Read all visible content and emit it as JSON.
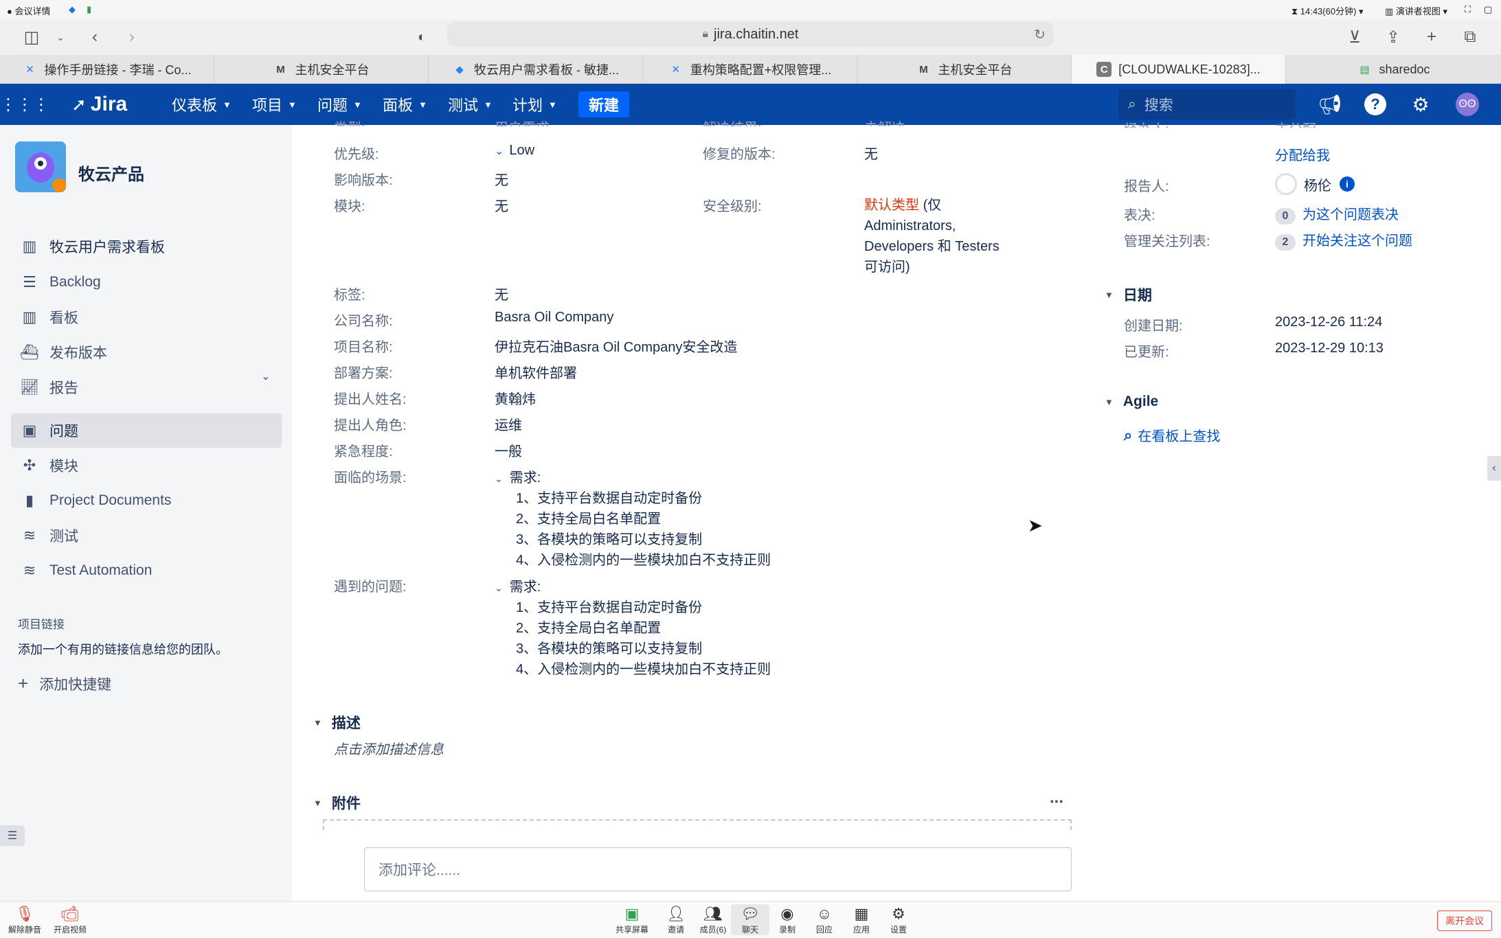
{
  "mac_bar": {
    "meeting_details": "会议详情",
    "time_remaining": "14:43(60分钟)",
    "presenter_view": "演讲者视图"
  },
  "browser": {
    "url": "jira.chaitin.net",
    "tabs": [
      {
        "label": "操作手册链接 - 李瑞 - Co...",
        "icon": "confluence-icon"
      },
      {
        "label": "主机安全平台",
        "icon": "gmail-icon"
      },
      {
        "label": "牧云用户需求看板 - 敏捷...",
        "icon": "jira-icon"
      },
      {
        "label": "重构策略配置+权限管理...",
        "icon": "confluence-icon"
      },
      {
        "label": "主机安全平台",
        "icon": "gmail-icon"
      },
      {
        "label": "[CLOUDWALKE-10283]...",
        "icon": "c-icon"
      },
      {
        "label": "sharedoc",
        "icon": "sharedoc-icon"
      }
    ]
  },
  "jira_header": {
    "logo": "Jira",
    "menus": [
      "仪表板",
      "项目",
      "问题",
      "面板",
      "测试",
      "计划"
    ],
    "create": "新建",
    "search_placeholder": "搜索"
  },
  "sidebar": {
    "project_name": "牧云产品",
    "board_name": "牧云用户需求看板",
    "items": [
      {
        "label": "Backlog",
        "icon": "backlog-icon"
      },
      {
        "label": "看板",
        "icon": "board-icon"
      },
      {
        "label": "发布版本",
        "icon": "ship-icon"
      },
      {
        "label": "报告",
        "icon": "chart-icon"
      },
      {
        "label": "问题",
        "icon": "issues-icon"
      },
      {
        "label": "模块",
        "icon": "puzzle-icon"
      },
      {
        "label": "Project Documents",
        "icon": "documents-icon"
      },
      {
        "label": "测试",
        "icon": "test-icon"
      },
      {
        "label": "Test Automation",
        "icon": "automation-icon"
      }
    ],
    "project_links_title": "项目链接",
    "project_links_desc": "添加一个有用的链接信息给您的团队。",
    "add_shortcut": "添加快捷键"
  },
  "details": {
    "cut_type_label": "类型:",
    "cut_type_value": "用户需求",
    "cut_resolution_label": "解决结果:",
    "cut_resolution_value": "未解决",
    "priority_label": "优先级:",
    "priority_value": "Low",
    "fix_version_label": "修复的版本:",
    "fix_version_value": "无",
    "affects_version_label": "影响版本:",
    "affects_version_value": "无",
    "component_label": "模块:",
    "component_value": "无",
    "security_label": "安全级别:",
    "security_type": "默认类型",
    "security_line1": "(仅",
    "security_line2": "Administrators,",
    "security_line3": "Developers 和 Testers",
    "security_line4": "可访问)",
    "labels_label": "标签:",
    "labels_value": "无",
    "company_label": "公司名称:",
    "company_value": "Basra Oil Company",
    "project_label": "项目名称:",
    "project_value": "伊拉克石油Basra Oil Company安全改造",
    "deploy_label": "部署方案:",
    "deploy_value": "单机软件部署",
    "submitter_label": "提出人姓名:",
    "submitter_value": "黄翰炜",
    "role_label": "提出人角色:",
    "role_value": "运维",
    "urgency_label": "紧急程度:",
    "urgency_value": "一般",
    "scenario_label": "面临的场景:",
    "scenario_head": "需求:",
    "scenario_items": [
      "1、支持平台数据自动定时备份",
      "2、支持全局白名单配置",
      "3、各模块的策略可以支持复制",
      "4、入侵检测内的一些模块加白不支持正则"
    ],
    "problem_label": "遇到的问题:",
    "problem_head": "需求:",
    "problem_items": [
      "1、支持平台数据自动定时备份",
      "2、支持全局白名单配置",
      "3、各模块的策略可以支持复制",
      "4、入侵检测内的一些模块加白不支持正则"
    ]
  },
  "description": {
    "title": "描述",
    "placeholder": "点击添加描述信息"
  },
  "attachments": {
    "title": "附件",
    "more": "..."
  },
  "comment": {
    "placeholder": "添加评论......"
  },
  "people": {
    "cut_assignee_label": "经办人:",
    "cut_assignee_value": "未分配",
    "assign_to_me": "分配给我",
    "reporter_label": "报告人:",
    "reporter_value": "杨伦",
    "votes_label": "表决:",
    "votes_count": "0",
    "vote_link": "为这个问题表决",
    "watchers_label": "管理关注列表:",
    "watchers_count": "2",
    "watch_link": "开始关注这个问题"
  },
  "dates": {
    "title": "日期",
    "created_label": "创建日期:",
    "created_value": "2023-12-26 11:24",
    "updated_label": "已更新:",
    "updated_value": "2023-12-29 10:13"
  },
  "agile": {
    "title": "Agile",
    "find_on_board": "在看板上查找"
  },
  "meeting_bar": {
    "unmute": "解除静音",
    "start_video": "开启视频",
    "share_screen": "共享屏幕",
    "invite": "邀请",
    "members": "成员(6)",
    "chat": "聊天",
    "record": "录制",
    "reactions": "回应",
    "apps": "应用",
    "settings": "设置",
    "leave": "离开会议"
  },
  "colors": {
    "jira_header": "#0747a6",
    "create_button": "#0065ff",
    "link": "#0052cc",
    "security_red": "#de350b",
    "sidebar_bg": "#f4f5f7"
  }
}
